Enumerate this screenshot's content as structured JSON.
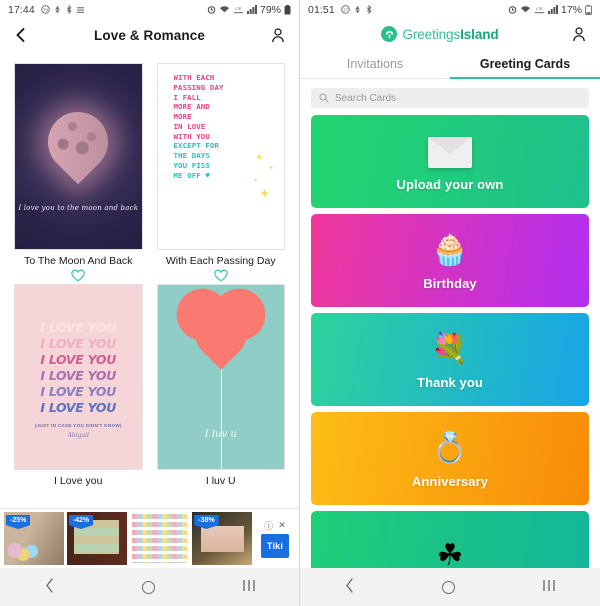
{
  "left": {
    "statusbar": {
      "time": "17:44",
      "icons": [
        "badge-icon",
        "data-rate-icon",
        "bluetooth-icon",
        "menu-icon"
      ],
      "right_icons": [
        "alarm-icon",
        "wifi-icon",
        "lte-icon",
        "signal-icon"
      ],
      "battery": "79%"
    },
    "header": {
      "back_icon": "back-arrow-icon",
      "title": "Love & Romance",
      "account_icon": "person-icon"
    },
    "cards": [
      {
        "caption": "To The Moon And Back",
        "art": "moon-heart",
        "script": "I love you  to the moon and back",
        "favorite_icon": "heart-outline-icon"
      },
      {
        "caption": "With Each Passing Day",
        "art": "text-card",
        "favorite_icon": "heart-outline-icon",
        "lines": [
          {
            "text": "WITH EACH",
            "color": "pink"
          },
          {
            "text": "PASSING DAY",
            "color": "pink"
          },
          {
            "text": "I FALL",
            "color": "pink"
          },
          {
            "text": "MORE AND",
            "color": "pink"
          },
          {
            "text": "MORE",
            "color": "pink"
          },
          {
            "text": "IN LOVE",
            "color": "pink"
          },
          {
            "text": "WITH YOU",
            "color": "pink"
          },
          {
            "text": "EXCEPT FOR",
            "color": "teal"
          },
          {
            "text": "THE DAYS",
            "color": "teal"
          },
          {
            "text": "YOU PISS",
            "color": "teal"
          },
          {
            "text": "ME OFF ♥",
            "color": "teal"
          }
        ]
      },
      {
        "caption": "I Love you",
        "art": "i-love-you-repeat",
        "repeat_text": "I LOVE YOU",
        "repeat_colors": [
          "#fbe3e6",
          "#f0aec2",
          "#d05f96",
          "#a96fb0",
          "#8druby",
          "#5b72c4"
        ],
        "subtitle": "(JUST IN CASE YOU DIDN'T KNOW)",
        "signature": "Abigail"
      },
      {
        "caption": "I luv U",
        "art": "heart-balloon",
        "script": "I luv u"
      }
    ],
    "ad": {
      "badges": [
        "-25%",
        "-42%",
        "-38%"
      ],
      "info_icon": "info-icon",
      "close_icon": "close-icon",
      "logo": "Tiki"
    },
    "navbar": {
      "back": "back-icon",
      "home": "home-icon",
      "recents": "recents-icon"
    }
  },
  "right": {
    "statusbar": {
      "time": "01:51",
      "battery": "17%"
    },
    "header": {
      "brand_first": "Greetings",
      "brand_second": "Island",
      "logo_icon": "greetings-island-logo-icon",
      "account_icon": "person-icon"
    },
    "tabs": [
      {
        "label": "Invitations",
        "active": false
      },
      {
        "label": "Greeting Cards",
        "active": true
      }
    ],
    "search": {
      "placeholder": "Search Cards",
      "icon": "search-icon"
    },
    "tiles": [
      {
        "label": "Upload your own",
        "art": "envelope-icon",
        "gradient": "linear-gradient(100deg,#22d56e 0%,#1fc08d 100%)"
      },
      {
        "label": "Birthday",
        "art": "🧁",
        "gradient": "linear-gradient(100deg,#f0389b 0%,#b22ff0 100%)"
      },
      {
        "label": "Thank you",
        "art": "💐",
        "gradient": "linear-gradient(100deg,#2ed39a 0%,#18a5e8 100%)"
      },
      {
        "label": "Anniversary",
        "art": "💍",
        "gradient": "linear-gradient(100deg,#fdbe15 0%,#f88b09 100%)"
      },
      {
        "label": "",
        "art": "☘",
        "gradient": "linear-gradient(100deg,#1fcf78 0%,#14b59a 100%)"
      }
    ],
    "navbar": {
      "back": "back-icon",
      "home": "home-icon",
      "recents": "recents-icon"
    }
  }
}
